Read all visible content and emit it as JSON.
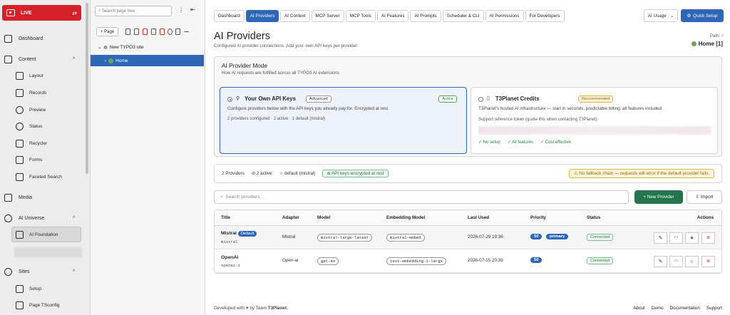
{
  "module_menu": {
    "live": {
      "label": "LIVE"
    },
    "items": [
      {
        "label": "Dashboard",
        "icon": "dashboard-icon"
      },
      {
        "label": "Content",
        "icon": "content-icon"
      },
      {
        "label": "Layout",
        "icon": "layout-icon"
      },
      {
        "label": "Records",
        "icon": "records-icon"
      },
      {
        "label": "Preview",
        "icon": "preview-icon"
      },
      {
        "label": "Status",
        "icon": "status-icon"
      },
      {
        "label": "Recycler",
        "icon": "recycler-icon"
      },
      {
        "label": "Forms",
        "icon": "forms-icon"
      },
      {
        "label": "Faceted Search",
        "icon": "faceted-search-icon"
      },
      {
        "label": "Media",
        "icon": "media-icon"
      },
      {
        "label": "AI Universe",
        "icon": "ai-universe-icon"
      },
      {
        "label": "AI Foundation",
        "icon": "ai-foundation-icon"
      },
      {
        "label": "Sites",
        "icon": "sites-icon"
      },
      {
        "label": "Setup",
        "icon": "setup-icon"
      },
      {
        "label": "Page TSconfig",
        "icon": "page-tsconfig-icon"
      }
    ]
  },
  "page_tree": {
    "search_placeholder": "Search page tree",
    "new_page_label": "+ Page",
    "root_label": "New TYPO3 site",
    "selected_label": "Home"
  },
  "tabs": [
    "Dashboard",
    "AI Providers",
    "AI Context",
    "MCP Server",
    "MCP Tools",
    "AI Features",
    "AI Prompts",
    "Scheduler & CLI",
    "AI Permissions",
    "For Developers"
  ],
  "ai_usage_label": "AI Usage",
  "quick_setup_label": "Quick Setup",
  "page": {
    "title": "AI Providers",
    "subtitle": "Configured AI provider connections. Add your own API keys per provider.",
    "path_label": "Path: /",
    "path_home": "Home [1]"
  },
  "mode": {
    "title": "AI Provider Mode",
    "subtitle": "How AI requests are fulfilled across all TYPO3 AI extensions",
    "own": {
      "title": "Your Own API Keys",
      "badge": "Advanced",
      "status": "Active",
      "desc": "Configure providers below with the API keys you already pay for. Encrypted at rest.",
      "meta": "2 providers configured  ·  2 active  ·  1 default (mistral)"
    },
    "credits": {
      "title": "T3Planet Credits",
      "badge": "Recommended",
      "desc": "T3Planet's hosted AI infrastructure — start in seconds, predictable billing, all features included.",
      "ref": "Support reference token (quote this when contacting T3Planet):",
      "features": [
        "✓ No setup",
        "✓ All features",
        "✓ Cost effective"
      ]
    }
  },
  "stats": {
    "providers": "2 Providers",
    "active": "⊘ 2 active",
    "default": "☆ default (mistral)",
    "encrypted": "⊕ API keys encrypted at rest",
    "warning": "⚠ No fallback chain — requests will error if the default provider fails."
  },
  "search_providers_placeholder": "Search providers...",
  "new_provider_label": "+ New Provider",
  "import_label": "Import",
  "table": {
    "headers": [
      "Title",
      "Adapter",
      "Model",
      "Embedding Model",
      "Last Used",
      "Priority",
      "Status",
      "Actions"
    ],
    "rows": [
      {
        "name": "Mistral",
        "default_badge": "Default",
        "code": "mistral",
        "adapter": "Mistral",
        "model": "mistral-large-latest",
        "embedding": "mistral-embed",
        "last_used": "2026-07-29 19:36",
        "priority": "50",
        "primary": "primary",
        "status": "Connected"
      },
      {
        "name": "OpenAI",
        "code": "openai-1",
        "adapter": "Open-ai",
        "model": "gpt-4o",
        "embedding": "text-embedding-3-large",
        "last_used": "2026-07-15 20:39",
        "priority": "50",
        "status": "Connected"
      }
    ]
  },
  "footer": {
    "credit_prefix": "Developed with",
    "credit_suffix": "by Team",
    "credit_brand": "T3Planet.",
    "links": [
      "About",
      "Demo",
      "Documentation",
      "Support"
    ]
  },
  "colors": {
    "accent": "#2f67b8",
    "live": "#d6202a",
    "success": "#23744a"
  }
}
